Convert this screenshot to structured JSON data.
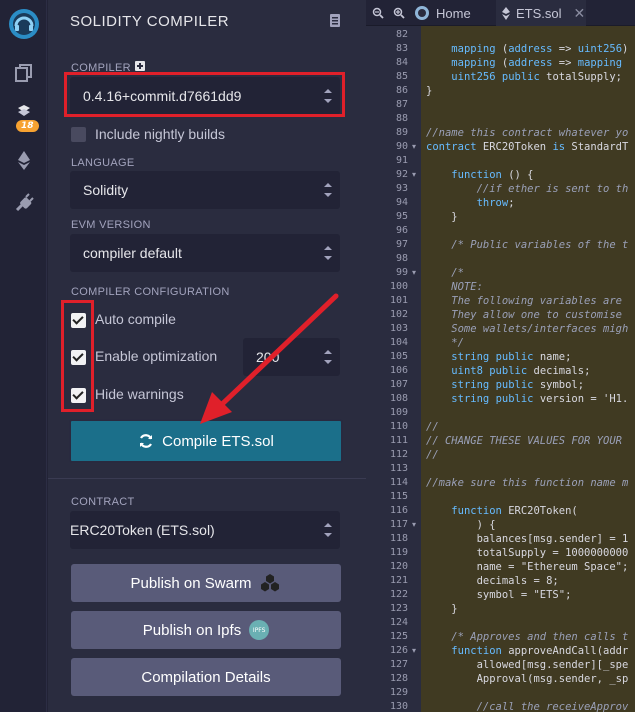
{
  "colors": {
    "accent": "#1b6f8a",
    "highlight": "#e0202a",
    "badge": "#f7a231"
  },
  "rail": {
    "badge": "18",
    "icons": [
      "remix-logo-icon",
      "files-icon",
      "compiler-icon",
      "ethereum-icon",
      "plugin-icon"
    ]
  },
  "panel": {
    "title": "SOLIDITY COMPILER",
    "compiler_label": "COMPILER",
    "compiler_value": "0.4.16+commit.d7661dd9",
    "nightly_label": "Include nightly builds",
    "language_label": "LANGUAGE",
    "language_value": "Solidity",
    "evm_label": "EVM VERSION",
    "evm_value": "compiler default",
    "config_label": "COMPILER CONFIGURATION",
    "auto_compile": "Auto compile",
    "enable_optimization": "Enable optimization",
    "optimization_runs": "200",
    "hide_warnings": "Hide warnings",
    "compile_button": "Compile ETS.sol",
    "contract_label": "CONTRACT",
    "contract_value": "ERC20Token (ETS.sol)",
    "publish_swarm": "Publish on Swarm",
    "publish_ipfs": "Publish on Ipfs",
    "ipfs_icon_text": "IPFS",
    "compilation_details": "Compilation Details"
  },
  "editor": {
    "tabs": [
      {
        "label": "Home"
      },
      {
        "label": "ETS.sol"
      }
    ],
    "line_numbers": [
      "82",
      "83",
      "84",
      "85",
      "86",
      "87",
      "88",
      "89",
      "90",
      "91",
      "92",
      "93",
      "94",
      "95",
      "96",
      "97",
      "98",
      "99",
      "100",
      "101",
      "102",
      "103",
      "104",
      "105",
      "106",
      "107",
      "108",
      "109",
      "110",
      "111",
      "112",
      "113",
      "114",
      "115",
      "116",
      "117",
      "118",
      "119",
      "120",
      "121",
      "122",
      "123",
      "124",
      "125",
      "126",
      "127",
      "128",
      "129",
      "130"
    ],
    "folds": {
      "90": "▾",
      "92": "▾",
      "99": "▾",
      "117": "▾",
      "126": "▾"
    },
    "code": [
      "",
      "    mapping (address => uint256)",
      "    mapping (address => mapping",
      "    uint256 public totalSupply;",
      "}",
      "",
      "",
      "//name this contract whatever yo",
      "contract ERC20Token is StandardT",
      "",
      "    function () {",
      "        //if ether is sent to th",
      "        throw;",
      "    }",
      "",
      "    /* Public variables of the t",
      "",
      "    /*",
      "    NOTE:",
      "    The following variables are",
      "    They allow one to customise",
      "    Some wallets/interfaces migh",
      "    */",
      "    string public name;",
      "    uint8 public decimals;",
      "    string public symbol;",
      "    string public version = 'H1.",
      "",
      "//",
      "// CHANGE THESE VALUES FOR YOUR",
      "//",
      "",
      "//make sure this function name m",
      "",
      "    function ERC20Token(",
      "        ) {",
      "        balances[msg.sender] = 1",
      "        totalSupply = 1000000000",
      "        name = \"Ethereum Space\";",
      "        decimals = 8;",
      "        symbol = \"ETS\";",
      "    }",
      "",
      "    /* Approves and then calls t",
      "    function approveAndCall(addr",
      "        allowed[msg.sender][_spe",
      "        Approval(msg.sender, _sp",
      "",
      "        //call the receiveApprov"
    ]
  }
}
